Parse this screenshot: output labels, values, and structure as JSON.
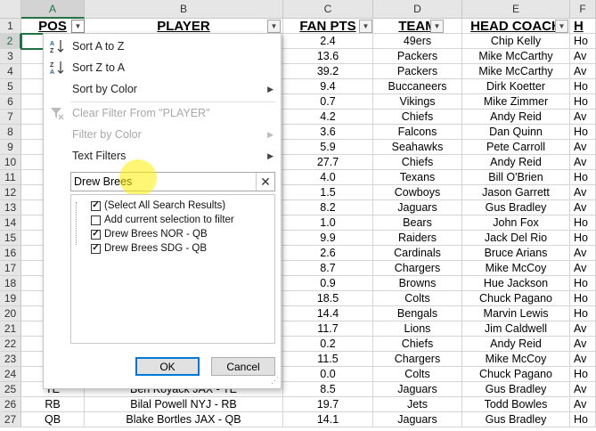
{
  "columns": [
    "A",
    "B",
    "C",
    "D",
    "E",
    "F"
  ],
  "headers": {
    "pos": "POS",
    "player": "PLAYER",
    "fan_pts": "FAN PTS",
    "team": "TEAM",
    "head_coach": "HEAD COACH",
    "f": "H"
  },
  "rows": [
    {
      "n": "1"
    },
    {
      "n": "2",
      "pos": "",
      "player": "",
      "pts": "2.4",
      "team": "49ers",
      "coach": "Chip Kelly",
      "f": "Ho"
    },
    {
      "n": "3",
      "pos": "",
      "player": "",
      "pts": "13.6",
      "team": "Packers",
      "coach": "Mike McCarthy",
      "f": "Av"
    },
    {
      "n": "4",
      "pos": "",
      "player": "",
      "pts": "39.2",
      "team": "Packers",
      "coach": "Mike McCarthy",
      "f": "Av"
    },
    {
      "n": "5",
      "pos": "",
      "player": "",
      "pts": "9.4",
      "team": "Buccaneers",
      "coach": "Dirk Koetter",
      "f": "Ho"
    },
    {
      "n": "6",
      "pos": "",
      "player": "",
      "pts": "0.7",
      "team": "Vikings",
      "coach": "Mike Zimmer",
      "f": "Ho"
    },
    {
      "n": "7",
      "pos": "",
      "player": "",
      "pts": "4.2",
      "team": "Chiefs",
      "coach": "Andy Reid",
      "f": "Av"
    },
    {
      "n": "8",
      "pos": "",
      "player": "",
      "pts": "3.6",
      "team": "Falcons",
      "coach": "Dan Quinn",
      "f": "Ho"
    },
    {
      "n": "9",
      "pos": "",
      "player": "",
      "pts": "5.9",
      "team": "Seahawks",
      "coach": "Pete Carroll",
      "f": "Av"
    },
    {
      "n": "10",
      "pos": "",
      "player": "",
      "pts": "27.7",
      "team": "Chiefs",
      "coach": "Andy Reid",
      "f": "Av"
    },
    {
      "n": "11",
      "pos": "",
      "player": "",
      "pts": "4.0",
      "team": "Texans",
      "coach": "Bill O'Brien",
      "f": "Ho"
    },
    {
      "n": "12",
      "pos": "",
      "player": "",
      "pts": "1.5",
      "team": "Cowboys",
      "coach": "Jason Garrett",
      "f": "Av"
    },
    {
      "n": "13",
      "pos": "",
      "player": "",
      "pts": "8.2",
      "team": "Jaguars",
      "coach": "Gus Bradley",
      "f": "Av"
    },
    {
      "n": "14",
      "pos": "",
      "player": "",
      "pts": "1.0",
      "team": "Bears",
      "coach": "John Fox",
      "f": "Ho"
    },
    {
      "n": "15",
      "pos": "",
      "player": "",
      "pts": "9.9",
      "team": "Raiders",
      "coach": "Jack Del Rio",
      "f": "Ho"
    },
    {
      "n": "16",
      "pos": "",
      "player": "",
      "pts": "2.6",
      "team": "Cardinals",
      "coach": "Bruce Arians",
      "f": "Av"
    },
    {
      "n": "17",
      "pos": "",
      "player": "",
      "pts": "8.7",
      "team": "Chargers",
      "coach": "Mike McCoy",
      "f": "Av"
    },
    {
      "n": "18",
      "pos": "",
      "player": "",
      "pts": "0.9",
      "team": "Browns",
      "coach": "Hue Jackson",
      "f": "Ho"
    },
    {
      "n": "19",
      "pos": "",
      "player": "",
      "pts": "18.5",
      "team": "Colts",
      "coach": "Chuck Pagano",
      "f": "Ho"
    },
    {
      "n": "20",
      "pos": "",
      "player": "",
      "pts": "14.4",
      "team": "Bengals",
      "coach": "Marvin Lewis",
      "f": "Ho"
    },
    {
      "n": "21",
      "pos": "",
      "player": "",
      "pts": "11.7",
      "team": "Lions",
      "coach": "Jim Caldwell",
      "f": "Av"
    },
    {
      "n": "22",
      "pos": "",
      "player": "",
      "pts": "0.2",
      "team": "Chiefs",
      "coach": "Andy Reid",
      "f": "Av"
    },
    {
      "n": "23",
      "pos": "",
      "player": "",
      "pts": "11.5",
      "team": "Chargers",
      "coach": "Mike McCoy",
      "f": "Av"
    },
    {
      "n": "24",
      "pos": "",
      "player": "",
      "pts": "0.0",
      "team": "Colts",
      "coach": "Chuck Pagano",
      "f": "Ho"
    },
    {
      "n": "25",
      "pos": "TE",
      "player": "Ben Koyack JAX - TE",
      "pts": "8.5",
      "team": "Jaguars",
      "coach": "Gus Bradley",
      "f": "Av"
    },
    {
      "n": "26",
      "pos": "RB",
      "player": "Bilal Powell NYJ - RB",
      "pts": "19.7",
      "team": "Jets",
      "coach": "Todd Bowles",
      "f": "Av"
    },
    {
      "n": "27",
      "pos": "QB",
      "player": "Blake Bortles JAX - QB",
      "pts": "14.1",
      "team": "Jaguars",
      "coach": "Gus Bradley",
      "f": "Ho"
    }
  ],
  "menu": {
    "sort_az": "Sort A to Z",
    "sort_za": "Sort Z to A",
    "sort_color": "Sort by Color",
    "clear_filter": "Clear Filter From \"PLAYER\"",
    "filter_color": "Filter by Color",
    "text_filters": "Text Filters",
    "search_value": "Drew Brees",
    "list": [
      {
        "label": "(Select All Search Results)",
        "checked": true
      },
      {
        "label": "Add current selection to filter",
        "checked": false
      },
      {
        "label": "Drew Brees NOR - QB",
        "checked": true
      },
      {
        "label": "Drew Brees SDG - QB",
        "checked": true
      }
    ],
    "ok": "OK",
    "cancel": "Cancel"
  },
  "colors": {
    "excel_green": "#217346",
    "ok_border": "#0078d7",
    "highlight": "#fff000"
  }
}
